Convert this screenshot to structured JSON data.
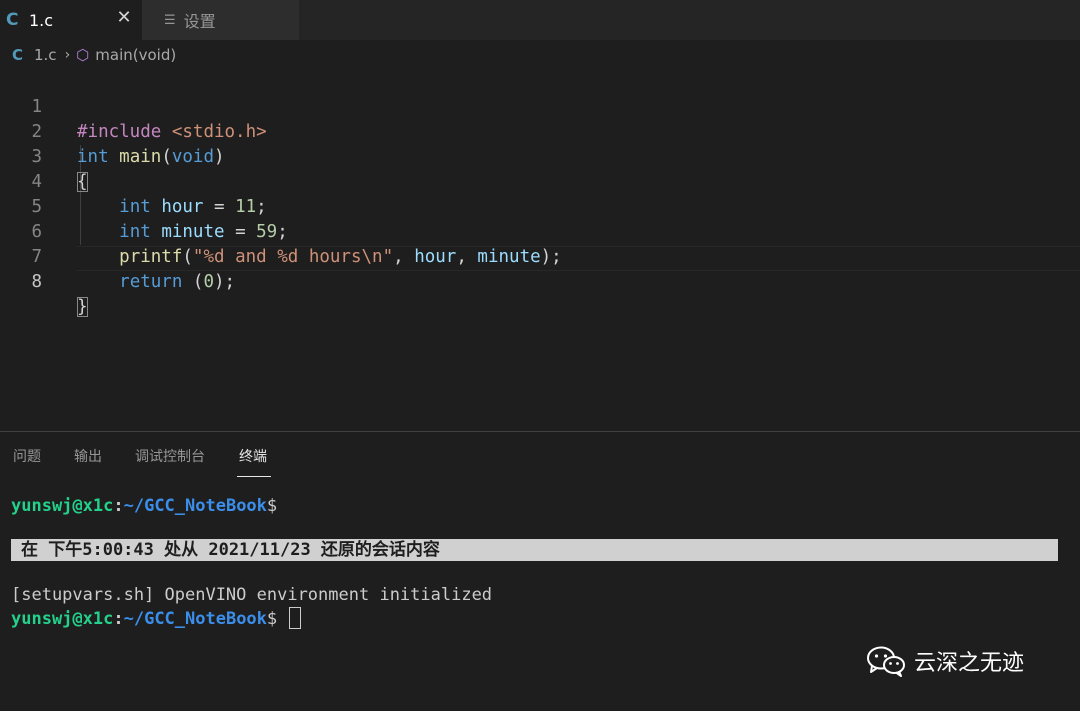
{
  "tabs": [
    {
      "icon": "C",
      "label": "1.c",
      "active": true
    },
    {
      "icon": "list-icon",
      "label": "设置",
      "active": false
    }
  ],
  "breadcrumb": {
    "file_icon": "C",
    "file": "1.c",
    "symbol": "main(void)"
  },
  "editor": {
    "line_numbers": [
      "1",
      "2",
      "3",
      "4",
      "5",
      "6",
      "7",
      "8"
    ],
    "lines": {
      "l1": {
        "directive": "#include",
        "header": "<stdio.h>"
      },
      "l2": {
        "type": "int",
        "name": "main",
        "open": "(",
        "param": "void",
        "close": ")"
      },
      "l3": {
        "brace": "{"
      },
      "l4": {
        "type": "int",
        "var": "hour",
        "op": " = ",
        "num": "11",
        "end": ";"
      },
      "l5": {
        "type": "int",
        "var": "minute",
        "op": " = ",
        "num": "59",
        "end": ";"
      },
      "l6": {
        "fn": "printf",
        "open": "(",
        "str": "\"%d and %d hours\\n\"",
        "sep1": ", ",
        "arg1": "hour",
        "sep2": ", ",
        "arg2": "minute",
        "end": ");"
      },
      "l7": {
        "kw": "return",
        "open": " (",
        "num": "0",
        "end": ");"
      },
      "l8": {
        "brace": "}"
      }
    }
  },
  "panel": {
    "tabs": [
      "问题",
      "输出",
      "调试控制台",
      "终端"
    ],
    "active_tab": "终端"
  },
  "terminal": {
    "user": "yunswj@x1c",
    "colon": ":",
    "path": "~/GCC_NoteBook",
    "dollar": "$",
    "restore_message": "在 下午5:00:43 处从 2021/11/23 还原的会话内容",
    "init_message": "[setupvars.sh] OpenVINO environment initialized"
  },
  "watermark": {
    "text": "云深之无迹",
    "icon": "wechat-icon"
  },
  "colors": {
    "accent_user": "#23d18b",
    "accent_path": "#3b8eea",
    "background": "#1e1e1e"
  }
}
